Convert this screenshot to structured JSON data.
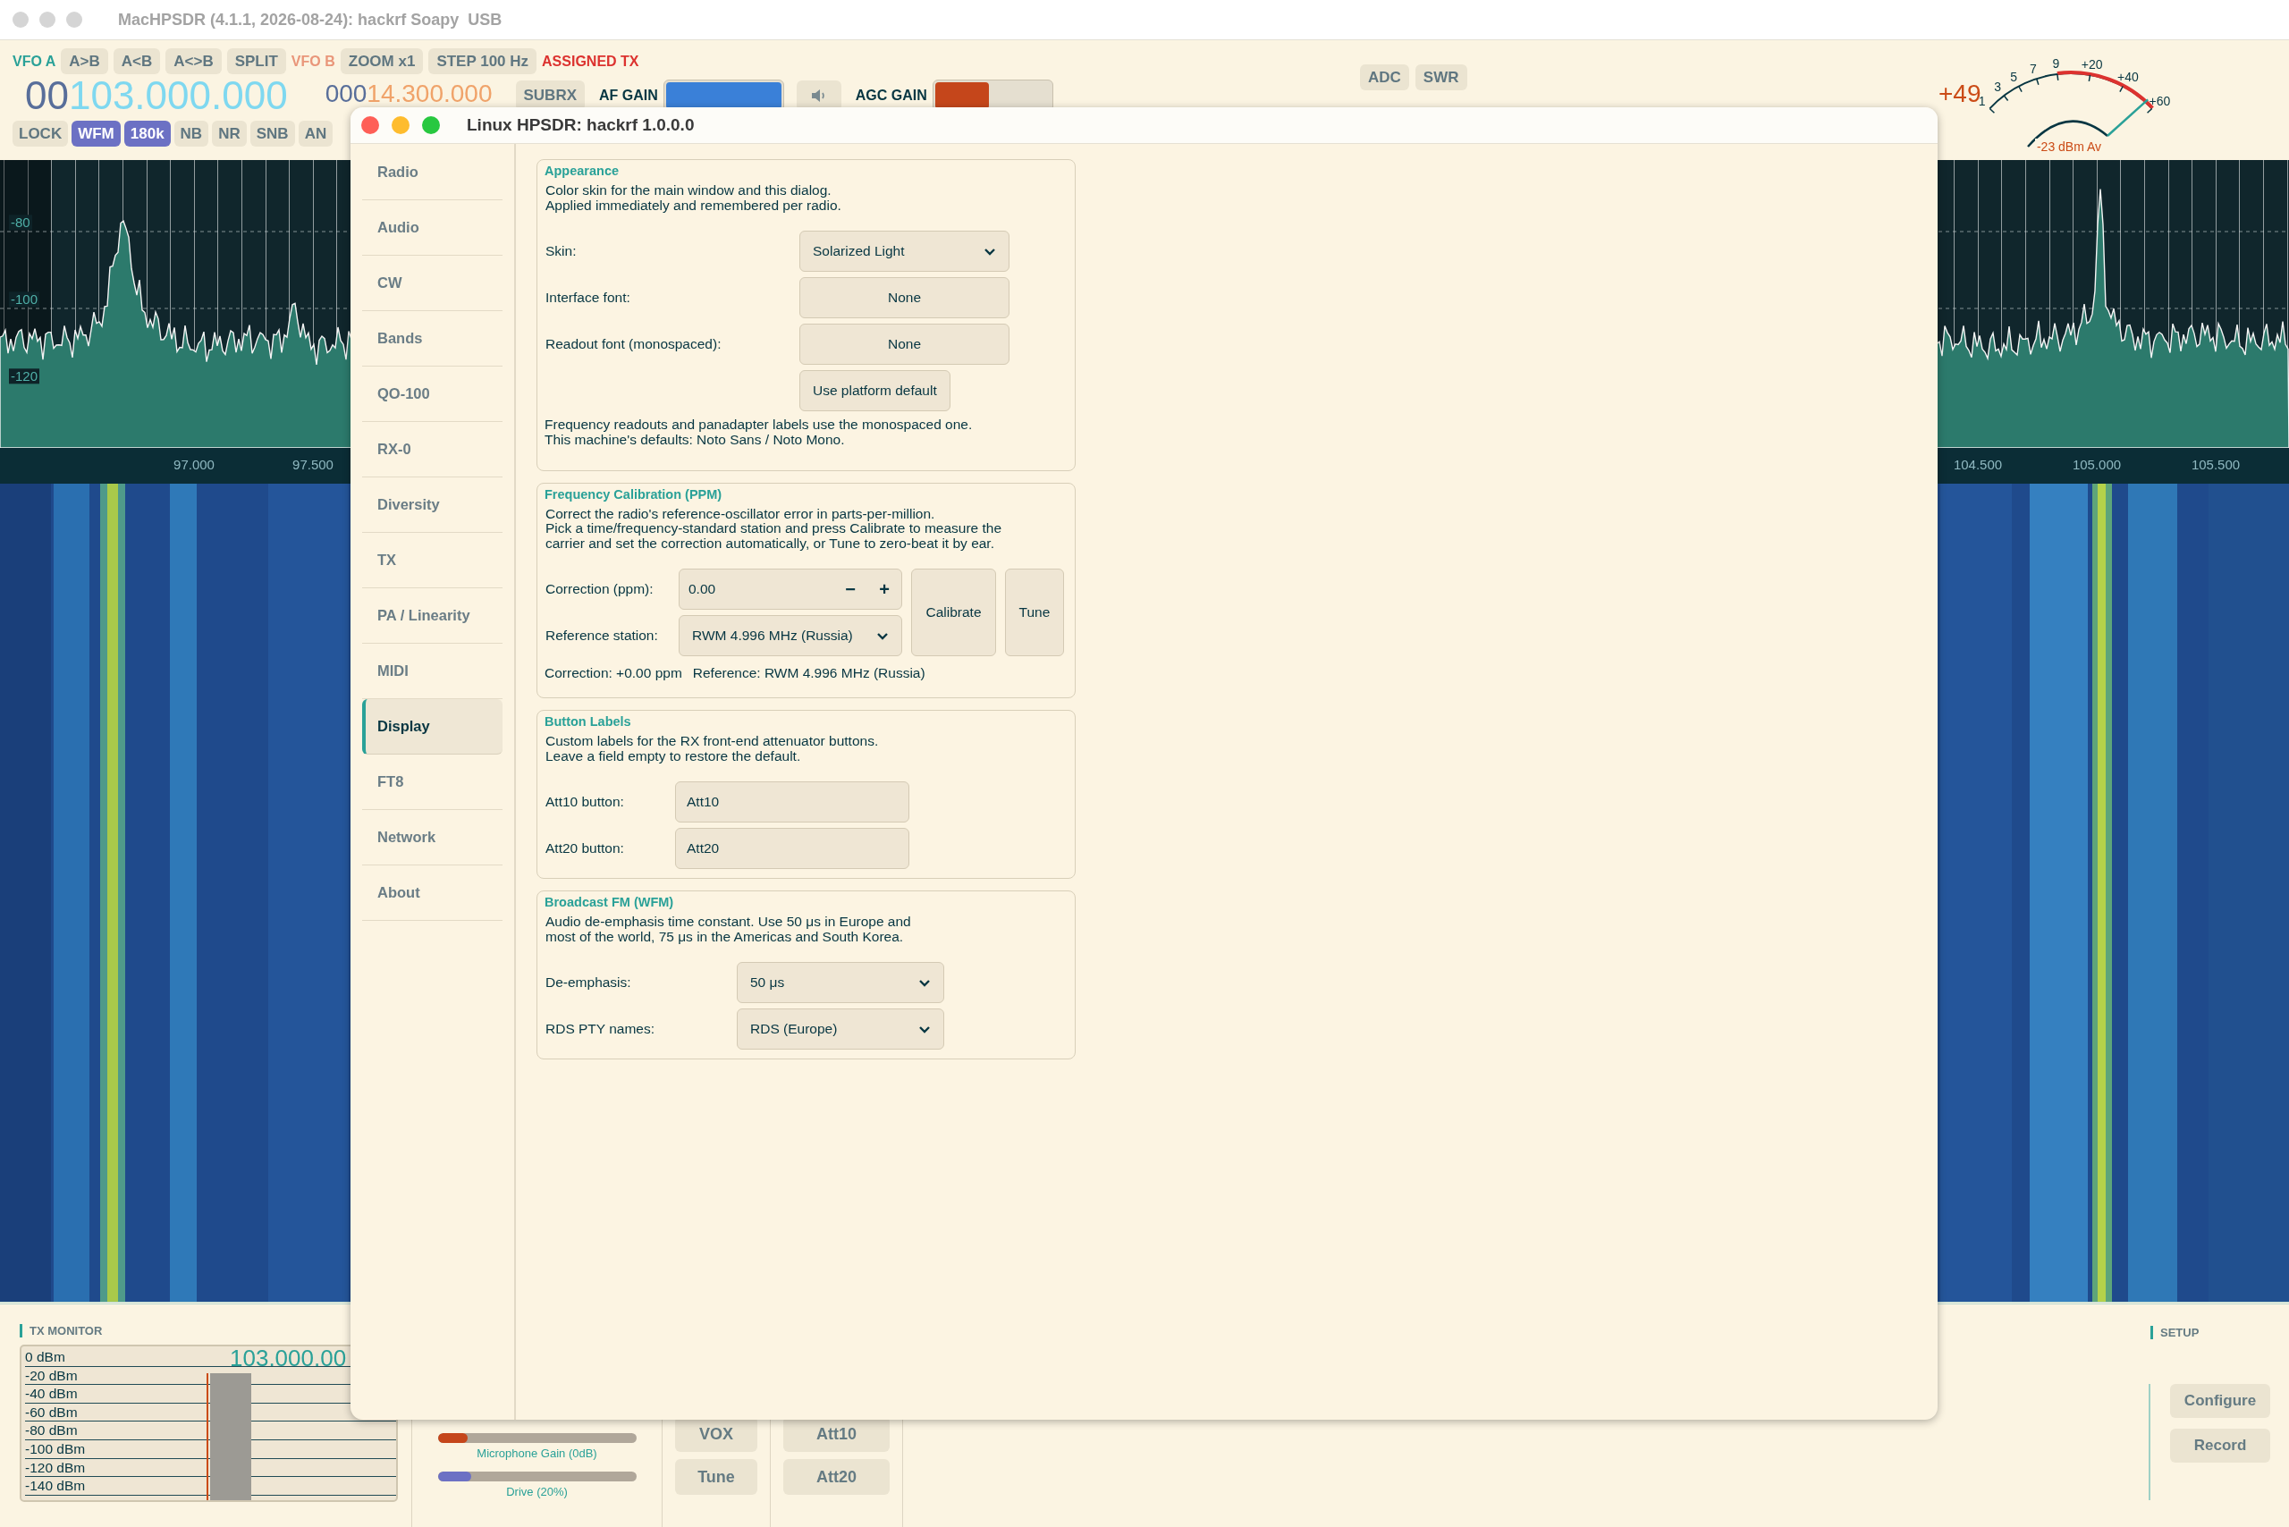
{
  "window": {
    "title": "MacHPSDR (4.1.1, 2026-08-24): hackrf Soapy  USB"
  },
  "toolbar": {
    "row1": [
      {
        "kind": "label",
        "text": "VFO A",
        "color": "#2aa198"
      },
      {
        "kind": "button",
        "text": "A>B"
      },
      {
        "kind": "button",
        "text": "A<B"
      },
      {
        "kind": "button",
        "text": "A<>B"
      },
      {
        "kind": "button",
        "text": "SPLIT"
      },
      {
        "kind": "label",
        "text": "VFO B",
        "color": "#e9967a"
      },
      {
        "kind": "button",
        "text": "ZOOM x1"
      },
      {
        "kind": "button",
        "text": "STEP 100 Hz"
      },
      {
        "kind": "label",
        "text": "ASSIGNED TX",
        "color": "#dc322f"
      }
    ],
    "vfo_a": {
      "prefix": "00",
      "frequency": "103.000.000"
    },
    "vfo_b": {
      "prefix": "000",
      "frequency": "14.300.000"
    },
    "subrx": "SUBRX",
    "af_gain": {
      "label": "AF GAIN",
      "level": 1
    },
    "agc_gain": {
      "label": "AGC GAIN",
      "level": 0.47
    },
    "row3": [
      {
        "text": "LOCK",
        "selected": false
      },
      {
        "text": "WFM",
        "selected": true
      },
      {
        "text": "180k",
        "selected": true
      },
      {
        "text": "NB",
        "selected": false
      },
      {
        "text": "NR",
        "selected": false
      },
      {
        "text": "SNB",
        "selected": false
      },
      {
        "text": "AN",
        "selected": false
      }
    ],
    "meter_buttons": [
      "ADC",
      "SWR"
    ]
  },
  "s_meter": {
    "exponent": "+49",
    "scale": [
      "1",
      "3",
      "5",
      "7",
      "9",
      "+20",
      "+40",
      "+60"
    ],
    "reading": "-23 dBm Av",
    "level": 0.95
  },
  "panadapter": {
    "db_labels": [
      "-80",
      "-100",
      "-120"
    ],
    "freq_labels": [
      "97.000",
      "97.500",
      "104.500",
      "105.000",
      "105.500"
    ]
  },
  "tx_monitor": {
    "title": "TX MONITOR",
    "frequency": "103.000.00",
    "scale": [
      "0 dBm",
      "-20 dBm",
      "-40 dBm",
      "-60 dBm",
      "-80 dBm",
      "-100 dBm",
      "-120 dBm",
      "-140 dBm"
    ]
  },
  "sliders": [
    {
      "label": "Microphone Gain (0dB)",
      "level": 0.15,
      "color": "#c5461b"
    },
    {
      "label": "Drive (20%)",
      "level": 0.17,
      "color": "#6c71c4"
    }
  ],
  "tx_buttons": [
    "VOX",
    "Tune"
  ],
  "att_buttons": [
    "Att10",
    "Att20"
  ],
  "setup": {
    "title": "SETUP",
    "buttons": [
      "Configure",
      "Record"
    ]
  },
  "dialog": {
    "title": "Linux HPSDR: hackrf 1.0.0.0",
    "sidebar": [
      {
        "label": "Radio",
        "selected": false
      },
      {
        "label": "Audio",
        "selected": false
      },
      {
        "label": "CW",
        "selected": false
      },
      {
        "label": "Bands",
        "selected": false
      },
      {
        "label": "QO-100",
        "selected": false
      },
      {
        "label": "RX-0",
        "selected": false
      },
      {
        "label": "Diversity",
        "selected": false
      },
      {
        "label": "TX",
        "selected": false
      },
      {
        "label": "PA / Linearity",
        "selected": false
      },
      {
        "label": "MIDI",
        "selected": false
      },
      {
        "label": "Display",
        "selected": true
      },
      {
        "label": "FT8",
        "selected": false
      },
      {
        "label": "Network",
        "selected": false
      },
      {
        "label": "About",
        "selected": false
      }
    ],
    "groups": [
      {
        "title": "Appearance",
        "description": [
          "Color skin for the main window and this dialog.",
          "Applied immediately and remembered per radio."
        ],
        "rows": [
          {
            "kind": "dropdown",
            "label": "Skin:",
            "value": "Solarized Light"
          },
          {
            "kind": "button",
            "label": "Interface font:",
            "value": "None"
          },
          {
            "kind": "button",
            "label": "Readout font (monospaced):",
            "value": "None"
          },
          {
            "kind": "button",
            "value": "Use platform default"
          }
        ],
        "note": [
          "Frequency readouts and panadapter labels use the monospaced one.",
          "This machine's defaults: Noto Sans / Noto Mono."
        ]
      },
      {
        "title": "Frequency Calibration (PPM)",
        "description": [
          "Correct the radio's reference-oscillator error in parts-per-million.",
          "Pick a time/frequency-standard station and press Calibrate to measure the",
          "carrier and set the correction automatically, or Tune to zero-beat it by ear."
        ],
        "rows": [
          {
            "kind": "stepper",
            "label": "Correction (ppm):",
            "value": "0.00",
            "minus": "−",
            "plus": "+"
          },
          {
            "kind": "dropdown",
            "label": "Reference station:",
            "value": "RWM 4.996 MHz (Russia)"
          }
        ],
        "actions": [
          "Calibrate",
          "Tune"
        ],
        "status": [
          "Correction: +0.00 ppm",
          "Reference: RWM 4.996 MHz (Russia)"
        ]
      },
      {
        "title": "Button Labels",
        "description": [
          "Custom labels for the RX front-end attenuator buttons.",
          "Leave a field empty to restore the default."
        ],
        "rows": [
          {
            "kind": "field",
            "label": "Att10 button:",
            "value": "Att10"
          },
          {
            "kind": "field",
            "label": "Att20 button:",
            "value": "Att20"
          }
        ]
      },
      {
        "title": "Broadcast FM (WFM)",
        "description": [
          "Audio de-emphasis time constant. Use 50 μs in Europe and",
          "most of the world, 75 μs in the Americas and South Korea."
        ],
        "rows": [
          {
            "kind": "dropdown",
            "label": "De-emphasis:",
            "value": "50 μs"
          },
          {
            "kind": "dropdown",
            "label": "RDS PTY names:",
            "value": "RDS (Europe)"
          }
        ]
      }
    ]
  }
}
